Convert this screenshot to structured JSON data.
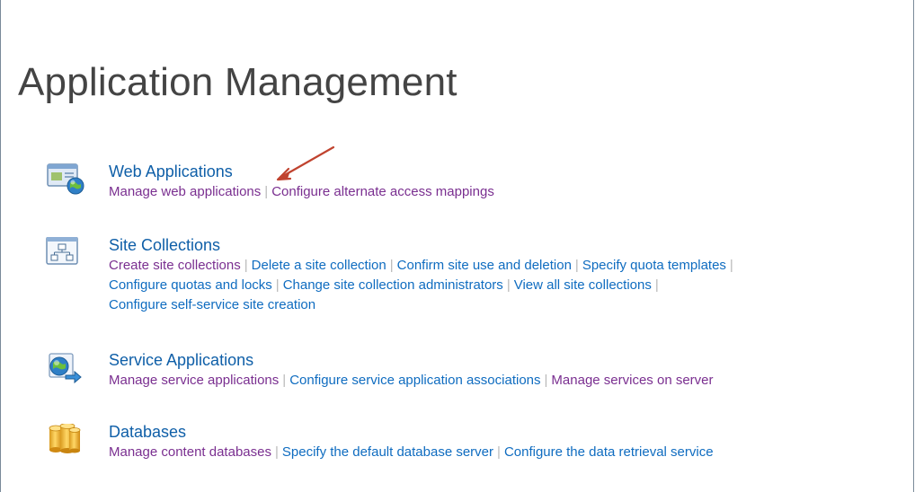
{
  "page": {
    "title": "Application Management"
  },
  "sections": [
    {
      "heading": "Web Applications",
      "icon": "web-application-globe-icon",
      "links": [
        "Manage web applications",
        "Configure alternate access mappings"
      ]
    },
    {
      "heading": "Site Collections",
      "icon": "site-hierarchy-icon",
      "links": [
        "Create site collections",
        "Delete a site collection",
        "Confirm site use and deletion",
        "Specify quota templates",
        "Configure quotas and locks",
        "Change site collection administrators",
        "View all site collections",
        "Configure self-service site creation"
      ]
    },
    {
      "heading": "Service Applications",
      "icon": "service-application-globe-icon",
      "links": [
        "Manage service applications",
        "Configure service application associations",
        "Manage services on server"
      ]
    },
    {
      "heading": "Databases",
      "icon": "database-cylinders-icon",
      "links": [
        "Manage content databases",
        "Specify the default database server",
        "Configure the data retrieval service"
      ]
    }
  ],
  "annotation": {
    "icon": "red-arrow-icon",
    "color": "#c0432f"
  },
  "colors": {
    "heading_link": "#0f5fa8",
    "visited_link": "#7a2f90",
    "unvisited_link": "#0f6cc0",
    "separator": "#b8b8b8",
    "title": "#444444"
  }
}
